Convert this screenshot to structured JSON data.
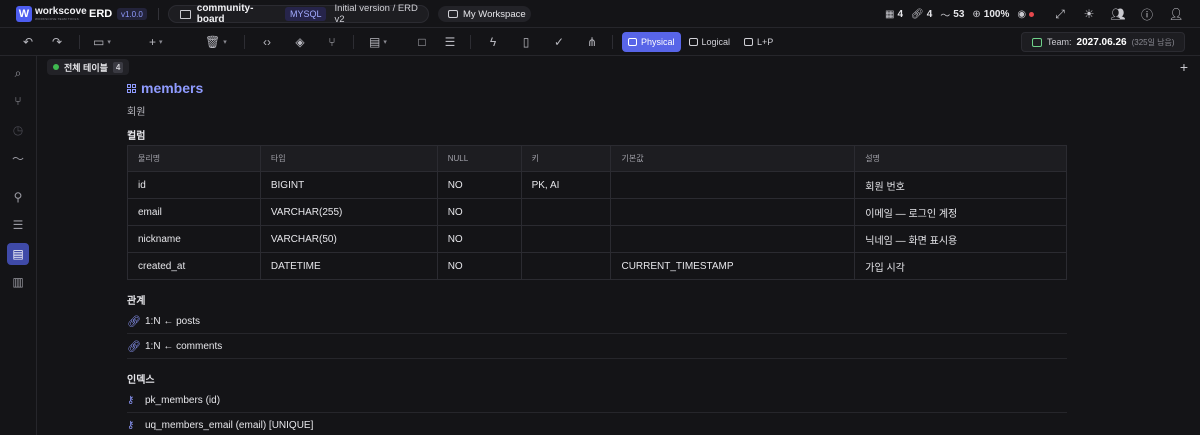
{
  "header": {
    "logo_letter": "W",
    "brand_name": "workscove",
    "brand_sub": "WORKSCOVE TEAM TOOLS",
    "app_label": "ERD",
    "version": "v1.0.0",
    "project_name": "community-board",
    "db_type": "MYSQL",
    "project_version": "Initial version / ERD v2",
    "workspace": "My Workspace",
    "stats": {
      "tables": "4",
      "relations": "4",
      "activity": "53",
      "zoom": "100%"
    }
  },
  "toolbar": {
    "views": [
      {
        "label": "Physical",
        "active": true
      },
      {
        "label": "Logical",
        "active": false
      },
      {
        "label": "L+P",
        "active": false
      }
    ],
    "team_label": "Team:",
    "team_date": "2027.06.26",
    "team_days_left": "(325일 남음)"
  },
  "tabs": [
    {
      "label": "전체 테이블",
      "count": "4"
    }
  ],
  "table": {
    "name": "members",
    "description": "회원",
    "columns_heading": "컬럼",
    "column_headers": [
      "물리명",
      "타입",
      "NULL",
      "키",
      "기본값",
      "설명"
    ],
    "columns": [
      [
        "id",
        "BIGINT",
        "NO",
        "PK, AI",
        "",
        "회원 번호"
      ],
      [
        "email",
        "VARCHAR(255)",
        "NO",
        "",
        "",
        "이메일 — 로그인 계정"
      ],
      [
        "nickname",
        "VARCHAR(50)",
        "NO",
        "",
        "",
        "닉네임 — 화면 표시용"
      ],
      [
        "created_at",
        "DATETIME",
        "NO",
        "",
        "CURRENT_TIMESTAMP",
        "가입 시각"
      ]
    ],
    "relations_heading": "관계",
    "relations": [
      "1:N ← posts",
      "1:N ← comments"
    ],
    "indexes_heading": "인덱스",
    "indexes": [
      "pk_members (id)",
      "uq_members_email (email) [UNIQUE]"
    ]
  },
  "colors": {
    "accent": "#5865e8",
    "accent_text": "#8f9bff",
    "status_dot": "#3fb950",
    "alert_dot": "#e5484d"
  }
}
